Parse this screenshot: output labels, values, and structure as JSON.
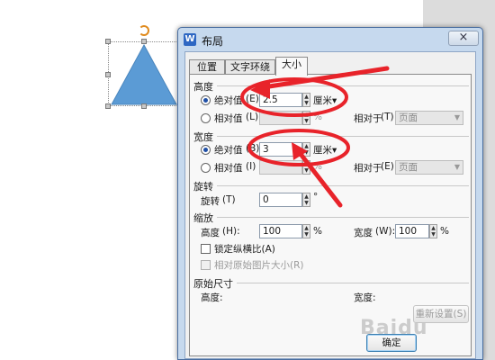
{
  "dialog": {
    "title": "布局",
    "icon_letter": "W",
    "close_label": "×",
    "tabs": [
      {
        "label": "位置",
        "active": false
      },
      {
        "label": "文字环绕",
        "active": false
      },
      {
        "label": "大小",
        "active": true
      }
    ]
  },
  "height": {
    "section": "高度",
    "absolute_label": "绝对值",
    "absolute_key": "(E)",
    "absolute_value": "2.5",
    "absolute_unit": "厘米▾",
    "relative_label": "相对值",
    "relative_key": "(L)",
    "relative_unit": "%",
    "relative_to_label": "相对于",
    "relative_to_key": "(T)",
    "relative_to_value": "页面"
  },
  "width": {
    "section": "宽度",
    "absolute_label": "绝对值",
    "absolute_key": "(B)",
    "absolute_value": "3",
    "absolute_unit": "厘米▾",
    "relative_label": "相对值",
    "relative_key": "(I)",
    "relative_unit": "%",
    "relative_to_label": "相对于",
    "relative_to_key": "(E)",
    "relative_to_value": "页面"
  },
  "rotate": {
    "section": "旋转",
    "label": "旋转",
    "key": "(T)",
    "value": "0",
    "unit": "°"
  },
  "scale": {
    "section": "缩放",
    "height_label": "高度",
    "height_key": "(H):",
    "height_value": "100",
    "height_unit": "%",
    "width_label": "宽度",
    "width_key": "(W):",
    "width_value": "100",
    "width_unit": "%",
    "lock_label": "锁定纵横比(A)",
    "lock_checked": false,
    "relative_original_label": "相对原始图片大小(R)",
    "relative_original_checked": false
  },
  "original": {
    "section": "原始尺寸",
    "height_label": "高度:",
    "width_label": "宽度:",
    "reset_label": "重新设置(S)"
  },
  "buttons": {
    "ok_label": "确定"
  },
  "watermark": "Baidu",
  "colors": {
    "shape_fill": "#5b9bd5",
    "annotation": "#e8232a",
    "dialog_frame": "#c6d9ee"
  }
}
